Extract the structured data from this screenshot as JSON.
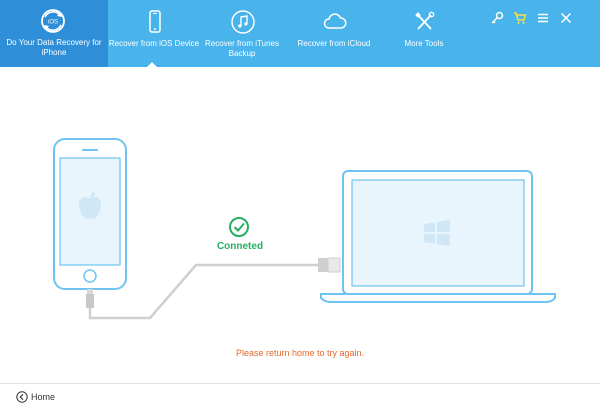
{
  "brand": {
    "title": "Do Your Data Recovery for iPhone",
    "badge": "iOS"
  },
  "nav": {
    "tabs": [
      {
        "label": "Recover from iOS Device",
        "active": true
      },
      {
        "label": "Recover from iTunes Backup",
        "active": false
      },
      {
        "label": "Recover from iCloud",
        "active": false
      },
      {
        "label": "More Tools",
        "active": false
      }
    ]
  },
  "header_actions": [
    "key-icon",
    "cart-icon",
    "menu-icon",
    "close-icon"
  ],
  "connection": {
    "status": "Conneted"
  },
  "message": "Please return home to try again.",
  "footer": {
    "home_label": "Home"
  },
  "colors": {
    "header": "#49b3ec",
    "brand": "#2e8fd8",
    "device_outline": "#6ec3f0",
    "status": "#27ae60",
    "error": "#e8672a"
  }
}
